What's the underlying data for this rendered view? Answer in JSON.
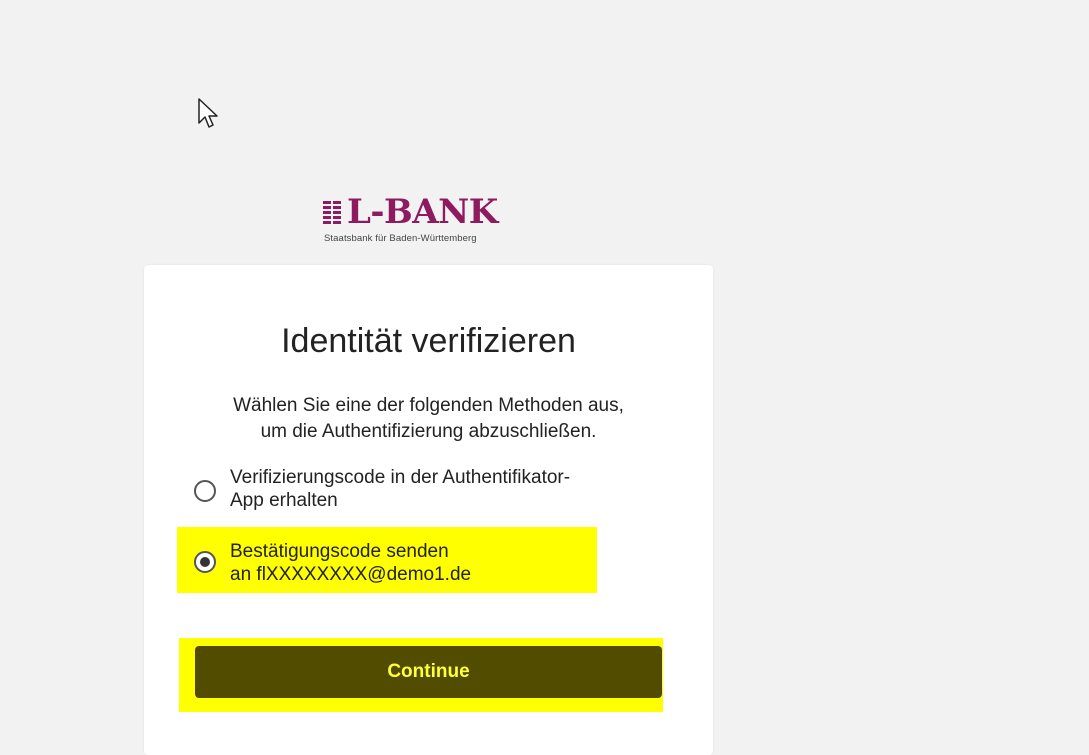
{
  "logo": {
    "name": "L-BANK",
    "subtitle": "Staatsbank für Baden-Württemberg",
    "brand_color": "#8e1b5f"
  },
  "card": {
    "title": "Identität verifizieren",
    "description_line1": "Wählen Sie eine der folgenden Methoden aus,",
    "description_line2": "um die Authentifizierung abzuschließen.",
    "options": [
      {
        "line1": "Verifizierungscode in der Authentifikator-",
        "line2": "App erhalten",
        "selected": false
      },
      {
        "line1": "Bestätigungscode senden",
        "line2": "an flXXXXXXXX@demo1.de",
        "selected": true
      }
    ],
    "continue_label": "Continue"
  },
  "colors": {
    "highlight": "#ffff00",
    "button_bg": "#514c00",
    "button_text": "#ffff3a",
    "page_bg": "#f2f2f2"
  },
  "icons": {
    "cursor": "mouse-pointer-icon",
    "logo_mark": "l-bank-emblem-icon",
    "radio_unselected": "radio-unchecked-icon",
    "radio_selected": "radio-checked-icon"
  }
}
